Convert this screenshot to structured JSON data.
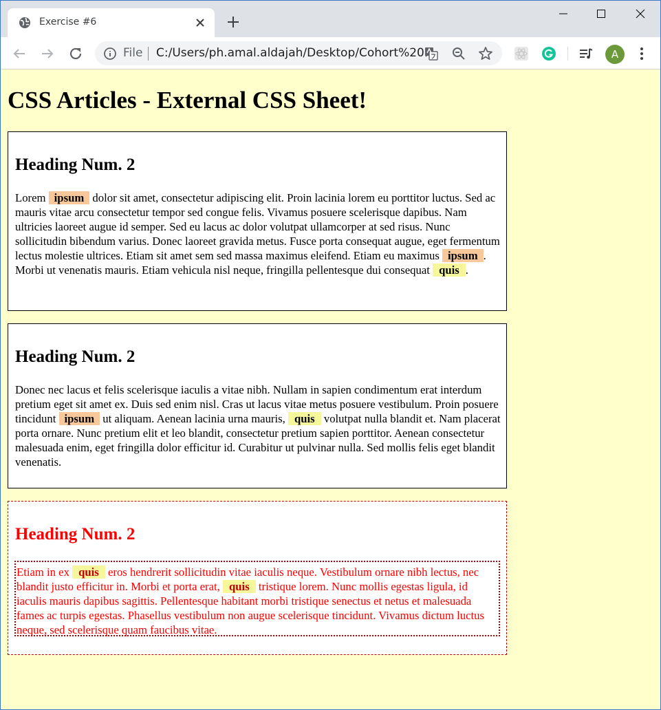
{
  "browser": {
    "tab_title": "Exercise #6",
    "file_label": "File",
    "url": "C:/Users/ph.amal.aldajah/Desktop/Cohort%20...",
    "avatar_letter": "A"
  },
  "page": {
    "title": "CSS Articles - External CSS Sheet!",
    "articles": [
      {
        "heading": "Heading Num. 2",
        "parts": [
          "Lorem ",
          "ipsum",
          " dolor sit amet, consectetur adipiscing elit. Proin lacinia lorem eu porttitor luctus. Sed ac mauris vitae arcu consectetur tempor sed congue felis. Vivamus posuere scelerisque dapibus. Nam ultricies laoreet augue id semper. Sed eu lacus ac dolor volutpat ullamcorper at sed risus. Nunc sollicitudin bibendum varius. Donec laoreet gravida metus. Fusce porta consequat augue, eget fermentum lectus molestie ultrices. Etiam sit amet sem sed massa maximus eleifend. Etiam eu maximus ",
          "ipsum",
          ". Morbi ut venenatis mauris. Etiam vehicula nisl neque, fringilla pellentesque dui consequat ",
          "quis",
          "."
        ]
      },
      {
        "heading": "Heading Num. 2",
        "parts": [
          "Donec nec lacus et felis scelerisque iaculis a vitae nibh. Nullam in sapien condimentum erat interdum pretium eget sit amet ex. Duis sed enim nisl. Cras ut lacus vitae metus posuere vestibulum. Proin posuere tincidunt ",
          "ipsum",
          " ut aliquam. Aenean lacinia urna mauris, ",
          "quis",
          " volutpat nulla blandit et. Nam placerat porta ornare. Nunc pretium elit et leo blandit, consectetur pretium sapien porttitor. Aenean consectetur malesuada enim, eget fringilla dolor efficitur id. Curabitur ut pulvinar nulla. Sed mollis felis eget blandit venenatis."
        ]
      },
      {
        "heading": "Heading Num. 2",
        "parts": [
          "Etiam in ex ",
          "quis",
          " eros hendrerit sollicitudin vitae iaculis neque. Vestibulum ornare nibh lectus, nec blandit justo efficitur in. Morbi et porta erat, ",
          "quis",
          " tristique lorem. Nunc mollis egestas ligula, id iaculis mauris dapibus sagittis. Pellentesque habitant morbi tristique senectus et netus et malesuada fames ac turpis egestas. Phasellus vestibulum non augue scelerisque tincidunt. Vivamus dictum luctus neque, sed scelerisque quam faucibus vitae."
        ]
      }
    ]
  },
  "colors": {
    "page_background": "#ffffcc",
    "ipsum_highlight": "#f8c89a",
    "quis_highlight": "#f6f69a",
    "accent_red": "#ff0000"
  }
}
